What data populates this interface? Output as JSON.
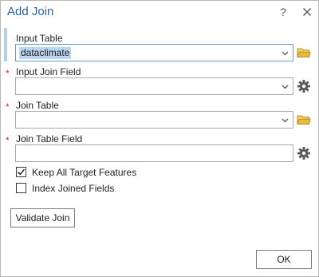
{
  "window": {
    "title": "Add Join",
    "help": "?"
  },
  "fields": {
    "input_table": {
      "label": "Input Table",
      "value": "dataclimate",
      "icon": "folder-icon"
    },
    "input_join_field": {
      "label": "Input Join Field",
      "required_marker": "*",
      "value": "",
      "icon": "gear-icon"
    },
    "join_table": {
      "label": "Join Table",
      "required_marker": "*",
      "value": "",
      "icon": "folder-icon"
    },
    "join_table_field": {
      "label": "Join Table Field",
      "required_marker": "*",
      "value": "",
      "icon": "gear-icon"
    }
  },
  "options": {
    "keep_all": {
      "label": "Keep All Target Features",
      "checked": true
    },
    "index_joined": {
      "label": "Index Joined Fields",
      "checked": false
    }
  },
  "buttons": {
    "validate": "Validate Join",
    "ok": "OK"
  },
  "colors": {
    "title": "#2564ab",
    "required": "#c0392b",
    "selection": "#bcd6f1",
    "folder": "#d9b43c"
  }
}
